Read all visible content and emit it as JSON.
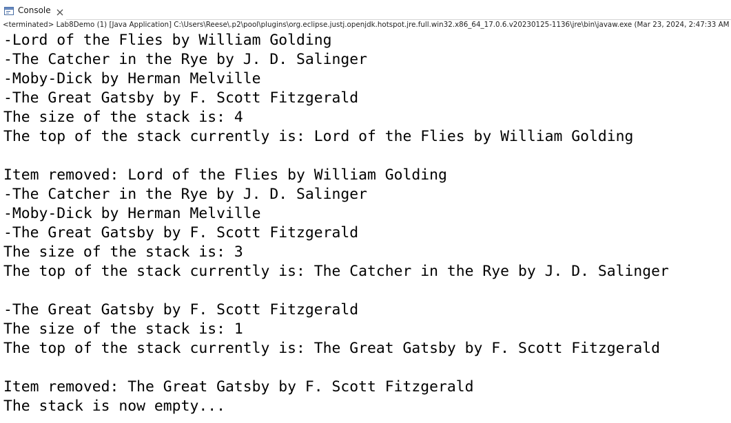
{
  "tab": {
    "label": "Console",
    "icon": "console-icon",
    "close_icon": "close-icon"
  },
  "status_line": "<terminated> Lab8Demo (1) [Java Application] C:\\Users\\Reese\\.p2\\pool\\plugins\\org.eclipse.justj.openjdk.hotspot.jre.full.win32.x86_64_17.0.6.v20230125-1136\\jre\\bin\\javaw.exe  (Mar 23, 2024, 2:47:33 AM",
  "console_lines": [
    "-Lord of the Flies by William Golding",
    "-The Catcher in the Rye by J. D. Salinger",
    "-Moby-Dick by Herman Melville",
    "-The Great Gatsby by F. Scott Fitzgerald",
    "The size of the stack is: 4",
    "The top of the stack currently is: Lord of the Flies by William Golding",
    "",
    "Item removed: Lord of the Flies by William Golding",
    "-The Catcher in the Rye by J. D. Salinger",
    "-Moby-Dick by Herman Melville",
    "-The Great Gatsby by F. Scott Fitzgerald",
    "The size of the stack is: 3",
    "The top of the stack currently is: The Catcher in the Rye by J. D. Salinger",
    "",
    "-The Great Gatsby by F. Scott Fitzgerald",
    "The size of the stack is: 1",
    "The top of the stack currently is: The Great Gatsby by F. Scott Fitzgerald",
    "",
    "Item removed: The Great Gatsby by F. Scott Fitzgerald",
    "The stack is now empty..."
  ]
}
